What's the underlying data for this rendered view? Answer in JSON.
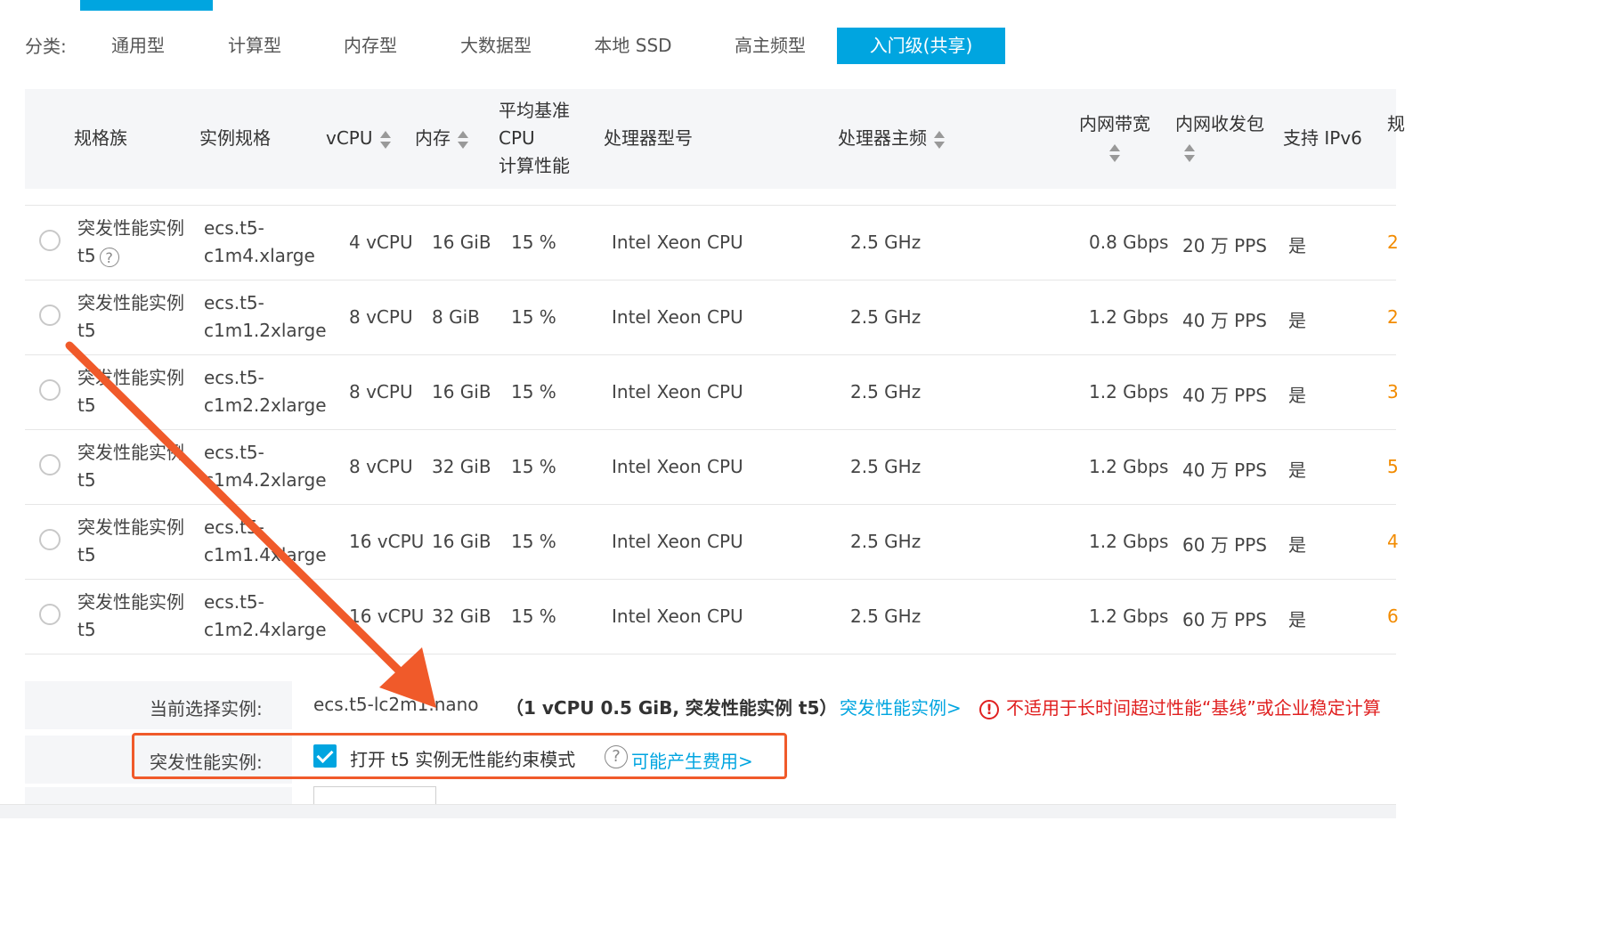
{
  "categories": {
    "label": "分类:",
    "tabs": [
      "通用型",
      "计算型",
      "内存型",
      "大数据型",
      "本地 SSD",
      "高主频型",
      "入门级(共享)"
    ],
    "active_index": 6
  },
  "table": {
    "headers": {
      "family": "规格族",
      "spec": "实例规格",
      "vcpu": "vCPU",
      "memory": "内存",
      "baseline_1": "平均基准",
      "baseline_2": "CPU",
      "baseline_3": "计算性能",
      "processor": "处理器型号",
      "frequency": "处理器主频",
      "bandwidth": "内网带宽",
      "pps": "内网收发包",
      "ipv6": "支持 IPv6",
      "cut": "规"
    },
    "rows": [
      {
        "family_1": "突发性能实例",
        "family_2": "t5",
        "help": true,
        "spec_1": "ecs.t5-",
        "spec_2": "c1m4.xlarge",
        "vcpu": "4 vCPU",
        "memory": "16 GiB",
        "baseline": "15 %",
        "processor": "Intel Xeon CPU",
        "freq": "2.5 GHz",
        "bandwidth": "0.8 Gbps",
        "pps": "20 万 PPS",
        "ipv6": "是",
        "cut": "2"
      },
      {
        "family_1": "突发性能实例",
        "family_2": "t5",
        "help": false,
        "spec_1": "ecs.t5-",
        "spec_2": "c1m1.2xlarge",
        "vcpu": "8 vCPU",
        "memory": "8 GiB",
        "baseline": "15 %",
        "processor": "Intel Xeon CPU",
        "freq": "2.5 GHz",
        "bandwidth": "1.2 Gbps",
        "pps": "40 万 PPS",
        "ipv6": "是",
        "cut": "2"
      },
      {
        "family_1": "突发性能实例",
        "family_2": "t5",
        "help": false,
        "spec_1": "ecs.t5-",
        "spec_2": "c1m2.2xlarge",
        "vcpu": "8 vCPU",
        "memory": "16 GiB",
        "baseline": "15 %",
        "processor": "Intel Xeon CPU",
        "freq": "2.5 GHz",
        "bandwidth": "1.2 Gbps",
        "pps": "40 万 PPS",
        "ipv6": "是",
        "cut": "3"
      },
      {
        "family_1": "突发性能实例",
        "family_2": "t5",
        "help": false,
        "spec_1": "ecs.t5-",
        "spec_2": "c1m4.2xlarge",
        "vcpu": "8 vCPU",
        "memory": "32 GiB",
        "baseline": "15 %",
        "processor": "Intel Xeon CPU",
        "freq": "2.5 GHz",
        "bandwidth": "1.2 Gbps",
        "pps": "40 万 PPS",
        "ipv6": "是",
        "cut": "5"
      },
      {
        "family_1": "突发性能实例",
        "family_2": "t5",
        "help": false,
        "spec_1": "ecs.t5-",
        "spec_2": "c1m1.4xlarge",
        "vcpu": "16 vCPU",
        "memory": "16 GiB",
        "baseline": "15 %",
        "processor": "Intel Xeon CPU",
        "freq": "2.5 GHz",
        "bandwidth": "1.2 Gbps",
        "pps": "60 万 PPS",
        "ipv6": "是",
        "cut": "4"
      },
      {
        "family_1": "突发性能实例",
        "family_2": "t5",
        "help": false,
        "spec_1": "ecs.t5-",
        "spec_2": "c1m2.4xlarge",
        "vcpu": "16 vCPU",
        "memory": "32 GiB",
        "baseline": "15 %",
        "processor": "Intel Xeon CPU",
        "freq": "2.5 GHz",
        "bandwidth": "1.2 Gbps",
        "pps": "60 万 PPS",
        "ipv6": "是",
        "cut": "6"
      }
    ]
  },
  "selection": {
    "label": "当前选择实例:",
    "instance": "ecs.t5-lc2m1.nano",
    "detail": "（1 vCPU 0.5 GiB, 突发性能实例 t5）",
    "link": "突发性能实例>",
    "warning": "不适用于长时间超过性能“基线”或企业稳定计算"
  },
  "burst": {
    "label": "突发性能实例:",
    "checkbox_label": "打开 t5 实例无性能约束模式",
    "checked": true,
    "fee_link": "可能产生费用>"
  },
  "icons": {
    "help": "?",
    "warning": "!"
  },
  "colors": {
    "accent": "#00a5e0",
    "annotation": "#f05a2a",
    "warning": "#e02020",
    "price": "#f28b00"
  }
}
